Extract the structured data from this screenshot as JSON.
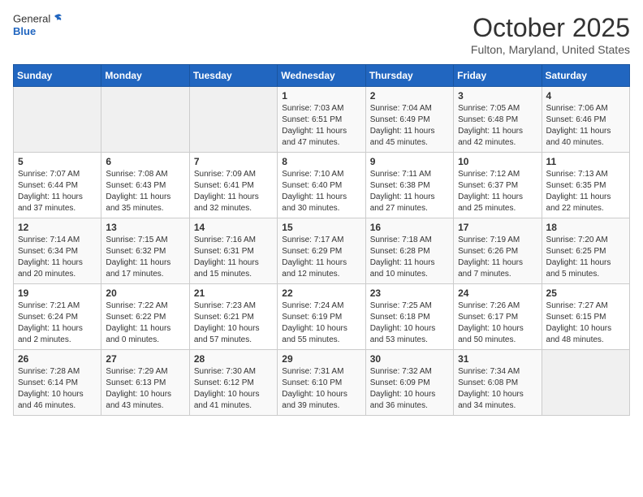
{
  "header": {
    "logo_general": "General",
    "logo_blue": "Blue",
    "month": "October 2025",
    "location": "Fulton, Maryland, United States"
  },
  "weekdays": [
    "Sunday",
    "Monday",
    "Tuesday",
    "Wednesday",
    "Thursday",
    "Friday",
    "Saturday"
  ],
  "weeks": [
    [
      {
        "day": "",
        "sunrise": "",
        "sunset": "",
        "daylight": ""
      },
      {
        "day": "",
        "sunrise": "",
        "sunset": "",
        "daylight": ""
      },
      {
        "day": "",
        "sunrise": "",
        "sunset": "",
        "daylight": ""
      },
      {
        "day": "1",
        "sunrise": "Sunrise: 7:03 AM",
        "sunset": "Sunset: 6:51 PM",
        "daylight": "Daylight: 11 hours and 47 minutes."
      },
      {
        "day": "2",
        "sunrise": "Sunrise: 7:04 AM",
        "sunset": "Sunset: 6:49 PM",
        "daylight": "Daylight: 11 hours and 45 minutes."
      },
      {
        "day": "3",
        "sunrise": "Sunrise: 7:05 AM",
        "sunset": "Sunset: 6:48 PM",
        "daylight": "Daylight: 11 hours and 42 minutes."
      },
      {
        "day": "4",
        "sunrise": "Sunrise: 7:06 AM",
        "sunset": "Sunset: 6:46 PM",
        "daylight": "Daylight: 11 hours and 40 minutes."
      }
    ],
    [
      {
        "day": "5",
        "sunrise": "Sunrise: 7:07 AM",
        "sunset": "Sunset: 6:44 PM",
        "daylight": "Daylight: 11 hours and 37 minutes."
      },
      {
        "day": "6",
        "sunrise": "Sunrise: 7:08 AM",
        "sunset": "Sunset: 6:43 PM",
        "daylight": "Daylight: 11 hours and 35 minutes."
      },
      {
        "day": "7",
        "sunrise": "Sunrise: 7:09 AM",
        "sunset": "Sunset: 6:41 PM",
        "daylight": "Daylight: 11 hours and 32 minutes."
      },
      {
        "day": "8",
        "sunrise": "Sunrise: 7:10 AM",
        "sunset": "Sunset: 6:40 PM",
        "daylight": "Daylight: 11 hours and 30 minutes."
      },
      {
        "day": "9",
        "sunrise": "Sunrise: 7:11 AM",
        "sunset": "Sunset: 6:38 PM",
        "daylight": "Daylight: 11 hours and 27 minutes."
      },
      {
        "day": "10",
        "sunrise": "Sunrise: 7:12 AM",
        "sunset": "Sunset: 6:37 PM",
        "daylight": "Daylight: 11 hours and 25 minutes."
      },
      {
        "day": "11",
        "sunrise": "Sunrise: 7:13 AM",
        "sunset": "Sunset: 6:35 PM",
        "daylight": "Daylight: 11 hours and 22 minutes."
      }
    ],
    [
      {
        "day": "12",
        "sunrise": "Sunrise: 7:14 AM",
        "sunset": "Sunset: 6:34 PM",
        "daylight": "Daylight: 11 hours and 20 minutes."
      },
      {
        "day": "13",
        "sunrise": "Sunrise: 7:15 AM",
        "sunset": "Sunset: 6:32 PM",
        "daylight": "Daylight: 11 hours and 17 minutes."
      },
      {
        "day": "14",
        "sunrise": "Sunrise: 7:16 AM",
        "sunset": "Sunset: 6:31 PM",
        "daylight": "Daylight: 11 hours and 15 minutes."
      },
      {
        "day": "15",
        "sunrise": "Sunrise: 7:17 AM",
        "sunset": "Sunset: 6:29 PM",
        "daylight": "Daylight: 11 hours and 12 minutes."
      },
      {
        "day": "16",
        "sunrise": "Sunrise: 7:18 AM",
        "sunset": "Sunset: 6:28 PM",
        "daylight": "Daylight: 11 hours and 10 minutes."
      },
      {
        "day": "17",
        "sunrise": "Sunrise: 7:19 AM",
        "sunset": "Sunset: 6:26 PM",
        "daylight": "Daylight: 11 hours and 7 minutes."
      },
      {
        "day": "18",
        "sunrise": "Sunrise: 7:20 AM",
        "sunset": "Sunset: 6:25 PM",
        "daylight": "Daylight: 11 hours and 5 minutes."
      }
    ],
    [
      {
        "day": "19",
        "sunrise": "Sunrise: 7:21 AM",
        "sunset": "Sunset: 6:24 PM",
        "daylight": "Daylight: 11 hours and 2 minutes."
      },
      {
        "day": "20",
        "sunrise": "Sunrise: 7:22 AM",
        "sunset": "Sunset: 6:22 PM",
        "daylight": "Daylight: 11 hours and 0 minutes."
      },
      {
        "day": "21",
        "sunrise": "Sunrise: 7:23 AM",
        "sunset": "Sunset: 6:21 PM",
        "daylight": "Daylight: 10 hours and 57 minutes."
      },
      {
        "day": "22",
        "sunrise": "Sunrise: 7:24 AM",
        "sunset": "Sunset: 6:19 PM",
        "daylight": "Daylight: 10 hours and 55 minutes."
      },
      {
        "day": "23",
        "sunrise": "Sunrise: 7:25 AM",
        "sunset": "Sunset: 6:18 PM",
        "daylight": "Daylight: 10 hours and 53 minutes."
      },
      {
        "day": "24",
        "sunrise": "Sunrise: 7:26 AM",
        "sunset": "Sunset: 6:17 PM",
        "daylight": "Daylight: 10 hours and 50 minutes."
      },
      {
        "day": "25",
        "sunrise": "Sunrise: 7:27 AM",
        "sunset": "Sunset: 6:15 PM",
        "daylight": "Daylight: 10 hours and 48 minutes."
      }
    ],
    [
      {
        "day": "26",
        "sunrise": "Sunrise: 7:28 AM",
        "sunset": "Sunset: 6:14 PM",
        "daylight": "Daylight: 10 hours and 46 minutes."
      },
      {
        "day": "27",
        "sunrise": "Sunrise: 7:29 AM",
        "sunset": "Sunset: 6:13 PM",
        "daylight": "Daylight: 10 hours and 43 minutes."
      },
      {
        "day": "28",
        "sunrise": "Sunrise: 7:30 AM",
        "sunset": "Sunset: 6:12 PM",
        "daylight": "Daylight: 10 hours and 41 minutes."
      },
      {
        "day": "29",
        "sunrise": "Sunrise: 7:31 AM",
        "sunset": "Sunset: 6:10 PM",
        "daylight": "Daylight: 10 hours and 39 minutes."
      },
      {
        "day": "30",
        "sunrise": "Sunrise: 7:32 AM",
        "sunset": "Sunset: 6:09 PM",
        "daylight": "Daylight: 10 hours and 36 minutes."
      },
      {
        "day": "31",
        "sunrise": "Sunrise: 7:34 AM",
        "sunset": "Sunset: 6:08 PM",
        "daylight": "Daylight: 10 hours and 34 minutes."
      },
      {
        "day": "",
        "sunrise": "",
        "sunset": "",
        "daylight": ""
      }
    ]
  ]
}
